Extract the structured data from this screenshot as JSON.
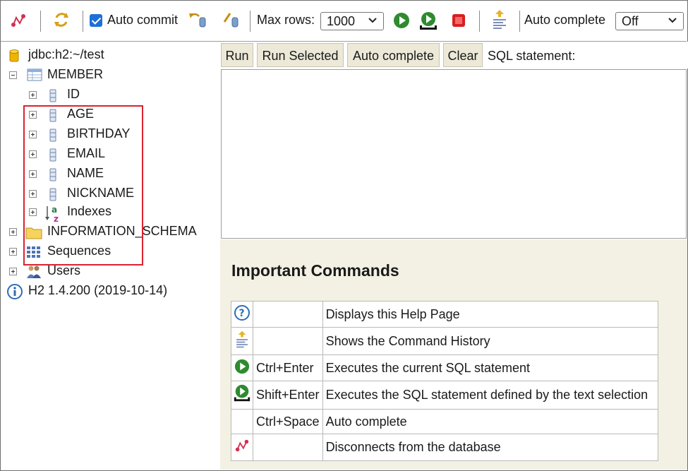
{
  "toolbar": {
    "auto_commit_label": "Auto commit",
    "auto_commit_checked": true,
    "max_rows_label": "Max rows:",
    "max_rows_value": "1000",
    "auto_complete_label": "Auto complete",
    "auto_complete_value": "Off"
  },
  "tree": {
    "connection": "jdbc:h2:~/test",
    "table": "MEMBER",
    "columns": [
      "ID",
      "AGE",
      "BIRTHDAY",
      "EMAIL",
      "NAME",
      "NICKNAME"
    ],
    "indexes": "Indexes",
    "schema": "INFORMATION_SCHEMA",
    "sequences": "Sequences",
    "users": "Users",
    "version": "H2 1.4.200 (2019-10-14)"
  },
  "buttons": {
    "run": "Run",
    "run_selected": "Run Selected",
    "auto_complete": "Auto complete",
    "clear": "Clear",
    "sql_label": "SQL statement:"
  },
  "help": {
    "title": "Important Commands",
    "rows": [
      {
        "icon": "help-icon",
        "key": "",
        "desc": "Displays this Help Page"
      },
      {
        "icon": "history-icon",
        "key": "",
        "desc": "Shows the Command History"
      },
      {
        "icon": "run-icon",
        "key": "Ctrl+Enter",
        "desc": "Executes the current SQL statement"
      },
      {
        "icon": "run-selected-icon",
        "key": "Shift+Enter",
        "desc": "Executes the SQL statement defined by the text selection"
      },
      {
        "icon": "",
        "key": "Ctrl+Space",
        "desc": "Auto complete"
      },
      {
        "icon": "disconnect-icon",
        "key": "",
        "desc": "Disconnects from the database"
      }
    ]
  },
  "colors": {
    "accent_highlight": "#d9222f",
    "run_green": "#2e8b2e",
    "stop_red": "#d62020",
    "panel_bg": "#f3f1e3",
    "button_bg": "#ece9d8"
  }
}
